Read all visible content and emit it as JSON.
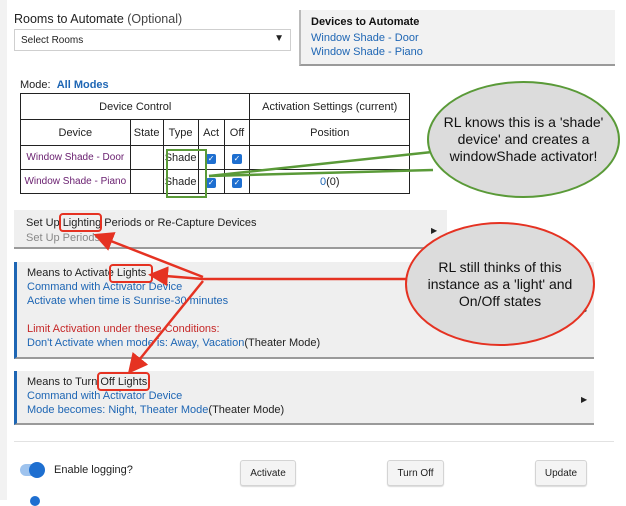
{
  "rooms": {
    "label": "Rooms to Automate",
    "optional": "(Optional)",
    "select_placeholder": "Select Rooms"
  },
  "devices": {
    "title": "Devices to Automate",
    "items": [
      "Window Shade - Door",
      "Window Shade - Piano"
    ]
  },
  "mode": {
    "label": "Mode:",
    "value": "All Modes"
  },
  "table": {
    "group_device_control": "Device Control",
    "group_activation": "Activation Settings (current)",
    "headers": [
      "Device",
      "State",
      "Type",
      "Act",
      "Off",
      "Position"
    ],
    "rows": [
      {
        "device": "Window Shade - Door",
        "state": "",
        "type": "Shade",
        "act": true,
        "off": true,
        "position": ""
      },
      {
        "device": "Window Shade - Piano",
        "state": "",
        "type": "Shade",
        "act": true,
        "off": true,
        "position_value": "0",
        "position_suffix": "(0)"
      }
    ]
  },
  "setup_panel": {
    "title_pre": "Set Up ",
    "title_hl": "Lighting",
    "title_post": " Periods or Re-Capture Devices",
    "subtitle": "Set Up Periods"
  },
  "activate_panel": {
    "title_pre": "Means to Activate ",
    "title_hl": "Lights",
    "line1": "Command with Activator Device",
    "line2": "Activate when time is Sunrise-30 minutes",
    "limit_title": "Limit Activation under these Conditions:",
    "limit_text": "Don't Activate when mode is: Away, Vacation",
    "limit_suffix": "(Theater Mode)"
  },
  "off_panel": {
    "title_pre": "Means to Turn ",
    "title_hl": "Off Lights",
    "line1": "Command with Activator Device",
    "line2": "Mode becomes: Night, Theater Mode",
    "line2_suffix": "(Theater Mode)"
  },
  "logging": {
    "label": "Enable logging?",
    "enabled": true
  },
  "buttons": {
    "activate": "Activate",
    "turn_off": "Turn Off",
    "update": "Update"
  },
  "callouts": {
    "green": "RL knows this is a 'shade' device' and creates a windowShade activator!",
    "red": "RL still thinks of this instance as a 'light' and On/Off states"
  },
  "colors": {
    "link_blue": "#1e66b4",
    "warning_red": "#c62828",
    "annotation_red": "#e53222",
    "annotation_green": "#5a9a38",
    "checkbox_blue": "#1e6fd0"
  }
}
